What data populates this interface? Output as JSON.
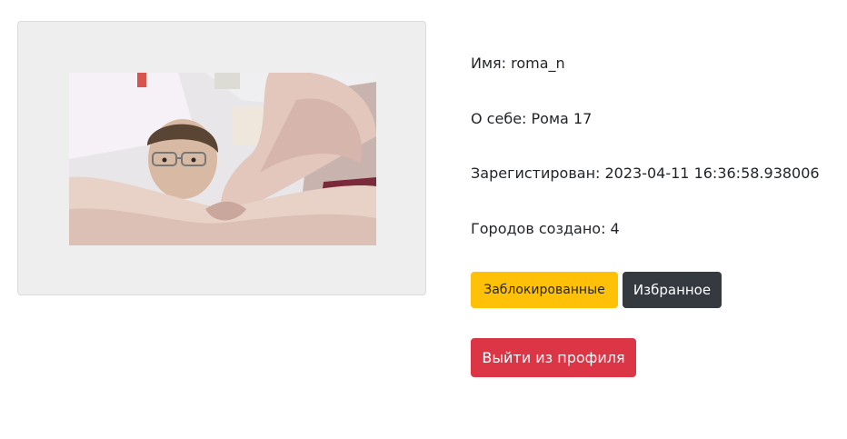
{
  "profile": {
    "name_line": "Имя: roma_n",
    "about_line": "О себе: Рома 17",
    "registered_line": "Зарегистирован: 2023-04-11 16:36:58.938006",
    "cities_line": "Городов создано: 4"
  },
  "buttons": {
    "blocked_label": "Заблокированные",
    "favorites_label": "Избранное",
    "logout_label": "Выйти из профиля"
  },
  "colors": {
    "card_background": "#eeeeee",
    "warning": "#ffc107",
    "dark": "#343a40",
    "danger": "#dc3545"
  }
}
